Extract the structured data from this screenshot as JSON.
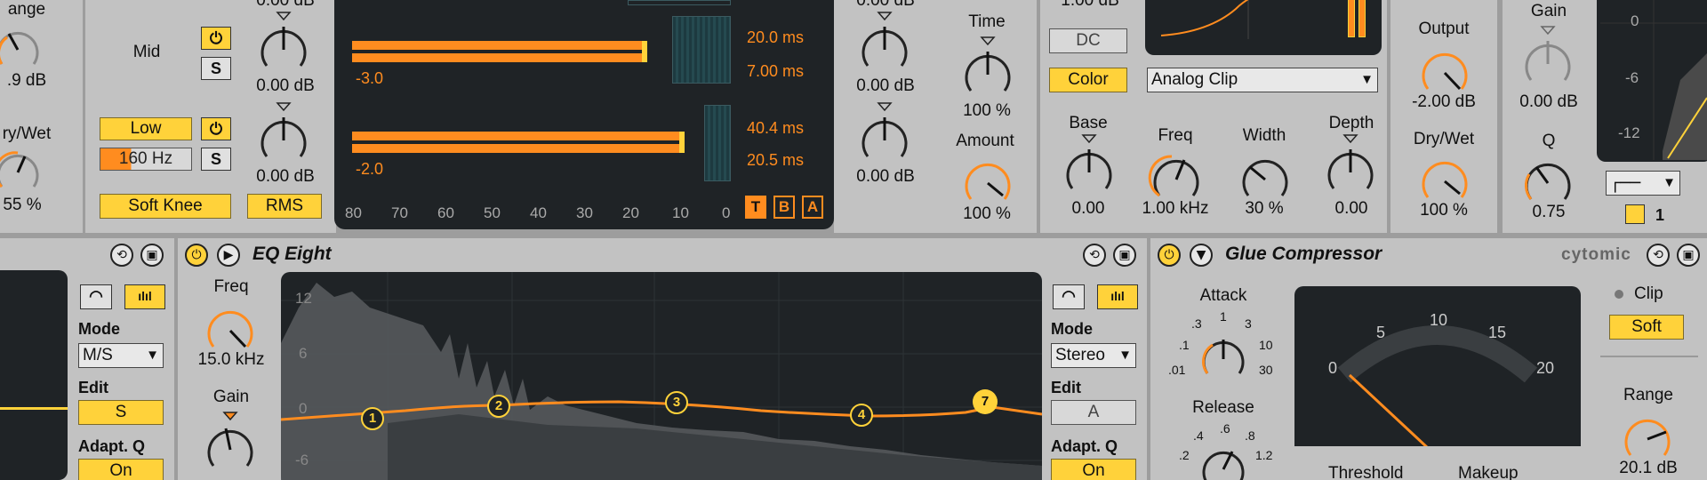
{
  "top": {
    "range_label": "ange",
    "range_value": ".9 dB",
    "drywet_label": "ry/Wet",
    "drywet_value": "55 %",
    "mid_label": "Mid",
    "mid_gain": "0.00 dB",
    "low_button": "Low",
    "low_freq": "160 Hz",
    "low_gain": "0.00 dB",
    "soft_knee": "Soft Knee",
    "rms": "RMS",
    "top_gain": "0.00 dB",
    "solo": "S",
    "meters": {
      "val1": "20.0 ms",
      "val2": "7.00 ms",
      "val3": "40.4 ms",
      "val4": "20.5 ms",
      "mark1": "-3.0",
      "mark2": "-2.0",
      "scale": [
        "80",
        "70",
        "60",
        "50",
        "40",
        "30",
        "20",
        "10",
        "0"
      ],
      "tba": [
        "T",
        "B",
        "A"
      ]
    },
    "knob_gain_a": "0.00 dB",
    "knob_gain_b": "0.00 dB",
    "knob_gain_c": "0.00 dB",
    "time_label": "Time",
    "time_value": "100 %",
    "amount_label": "Amount",
    "amount_value": "100 %",
    "saturator": {
      "top_value": "1.00 dB",
      "dc": "DC",
      "color": "Color",
      "mode": "Analog Clip",
      "base_label": "Base",
      "base_value": "0.00",
      "freq_label": "Freq",
      "freq_value": "1.00 kHz",
      "width_label": "Width",
      "width_value": "30 %",
      "depth_label": "Depth",
      "depth_value": "0.00",
      "output_label": "Output",
      "output_value": "-2.00 dB",
      "drywet_label": "Dry/Wet",
      "drywet_value": "100 %"
    },
    "right": {
      "gain_label": "Gain",
      "gain_value": "0.00 dB",
      "q_label": "Q",
      "q_value": "0.75",
      "band": "1",
      "scale": [
        "0",
        "-6",
        "-12"
      ]
    }
  },
  "left_strip": {
    "mode_label": "Mode",
    "mode_value": "M/S",
    "edit_label": "Edit",
    "edit_value": "S",
    "adapt_label": "Adapt. Q",
    "adapt_value": "On"
  },
  "eq": {
    "title": "EQ Eight",
    "freq_label": "Freq",
    "freq_value": "15.0 kHz",
    "gain_label": "Gain",
    "db_scale": [
      "12",
      "6",
      "0",
      "-6"
    ],
    "bands": [
      "1",
      "2",
      "3",
      "4",
      "7"
    ],
    "mode_label": "Mode",
    "mode_value": "Stereo",
    "edit_label": "Edit",
    "edit_value": "A",
    "adapt_label": "Adapt. Q",
    "adapt_value": "On"
  },
  "glue": {
    "title": "Glue Compressor",
    "brand": "cytomic",
    "attack_label": "Attack",
    "attack_ticks": [
      ".1",
      ".3",
      "1",
      "3",
      "10",
      "30",
      ".01"
    ],
    "release_label": "Release",
    "release_ticks": [
      ".2",
      ".4",
      ".6",
      ".8",
      "1.2"
    ],
    "meter_scale": [
      "0",
      "5",
      "10",
      "15",
      "20"
    ],
    "threshold_label": "Threshold",
    "makeup_label": "Makeup",
    "clip_label": "Clip",
    "clip_value": "Soft",
    "range_label": "Range",
    "range_value": "20.1 dB"
  },
  "colors": {
    "accent_orange": "#ff8c1f",
    "accent_yellow": "#ffd23a",
    "panel_gray": "#c2c2c2",
    "display_dark": "#1f2326"
  }
}
